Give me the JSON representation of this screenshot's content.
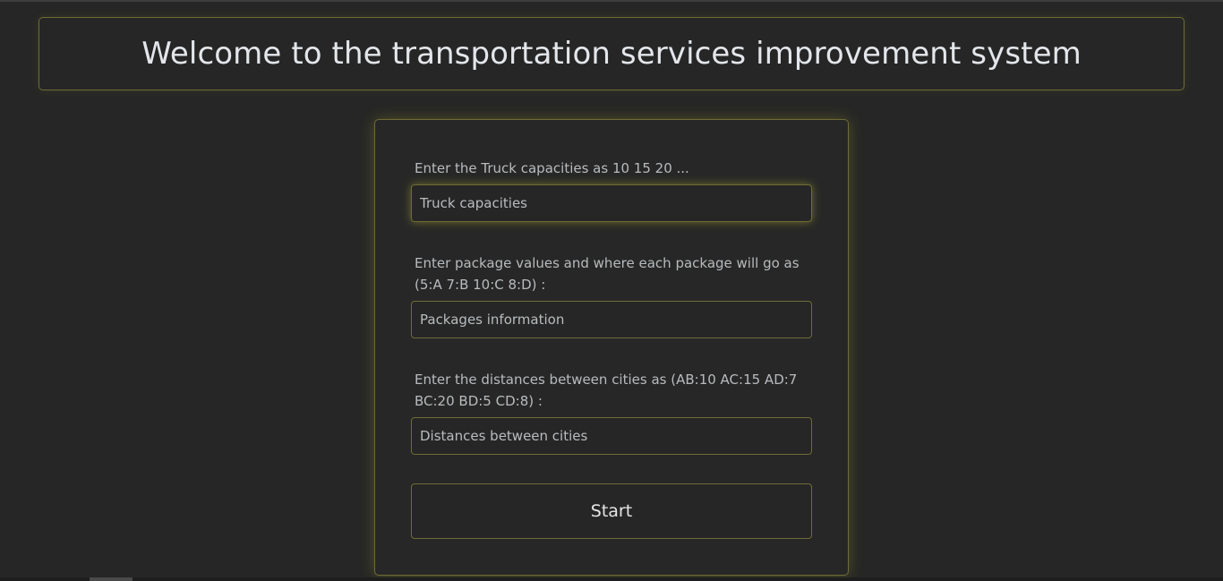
{
  "header": {
    "title": "Welcome to the transportation services improvement system"
  },
  "form": {
    "truck": {
      "label": "Enter the Truck capacities as 10 15 20 ...",
      "placeholder": "Truck capacities",
      "value": ""
    },
    "packages": {
      "label": "Enter package values and where each package will go as (5:A 7:B 10:C 8:D) :",
      "placeholder": "Packages information",
      "value": ""
    },
    "distances": {
      "label": "Enter the distances between cities as (AB:10 AC:15 AD:7 BC:20 BD:5 CD:8) :",
      "placeholder": "Distances between cities",
      "value": ""
    },
    "start_label": "Start"
  },
  "colors": {
    "background": "#262626",
    "border_accent": "#6f6c36",
    "title_text": "#e3e6ea",
    "label_text": "#b8bbbe"
  }
}
